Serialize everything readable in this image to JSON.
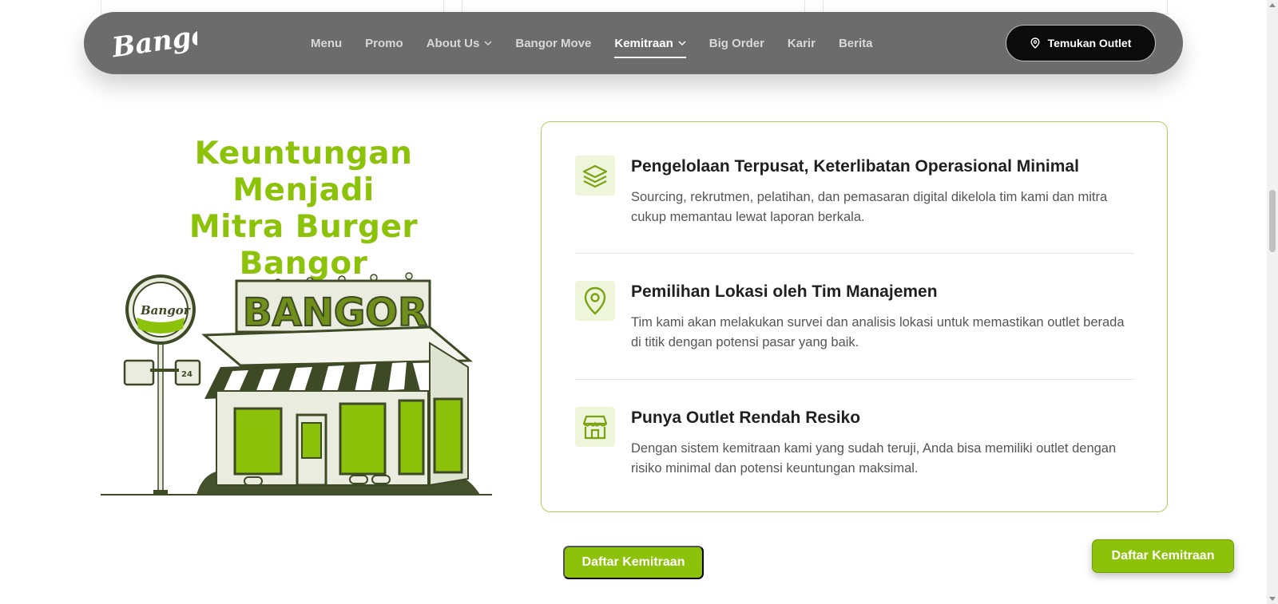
{
  "header": {
    "logo_text": "Bangor",
    "nav": [
      {
        "label": "Menu",
        "dropdown": false,
        "active": false
      },
      {
        "label": "Promo",
        "dropdown": false,
        "active": false
      },
      {
        "label": "About Us",
        "dropdown": true,
        "active": false
      },
      {
        "label": "Bangor Move",
        "dropdown": false,
        "active": false
      },
      {
        "label": "Kemitraan",
        "dropdown": true,
        "active": true
      },
      {
        "label": "Big Order",
        "dropdown": false,
        "active": false
      },
      {
        "label": "Karir",
        "dropdown": false,
        "active": false
      },
      {
        "label": "Berita",
        "dropdown": false,
        "active": false
      }
    ],
    "cta_label": "Temukan Outlet"
  },
  "section": {
    "heading_line1": "Keuntungan Menjadi",
    "heading_line2": "Mitra Burger Bangor",
    "store_sign": "BANGOR",
    "pole_sign": "Bangor",
    "open_hours": "24"
  },
  "benefits": [
    {
      "icon": "layers-icon",
      "title": "Pengelolaan Terpusat, Keterlibatan Operasional Minimal",
      "description": "Sourcing, rekrutmen, pelatihan, dan pemasaran digital dikelola tim kami dan mitra cukup memantau lewat laporan berkala."
    },
    {
      "icon": "location-pin-icon",
      "title": "Pemilihan Lokasi oleh Tim Manajemen",
      "description": "Tim kami akan melakukan survei dan analisis lokasi untuk memastikan outlet berada di titik dengan potensi pasar yang baik."
    },
    {
      "icon": "store-icon",
      "title": "Punya Outlet Rendah Resiko",
      "description": "Dengan sistem kemitraan kami yang sudah teruji, Anda bisa memiliki outlet dengan risiko minimal dan potensi keuntungan maksimal."
    }
  ],
  "buttons": {
    "register_label": "Daftar Kemitraan",
    "floating_register_label": "Daftar Kemitraan"
  },
  "colors": {
    "accent": "#8cc20a",
    "nav_bg": "#6c6c6c",
    "cta_bg": "#0b0b0b"
  }
}
